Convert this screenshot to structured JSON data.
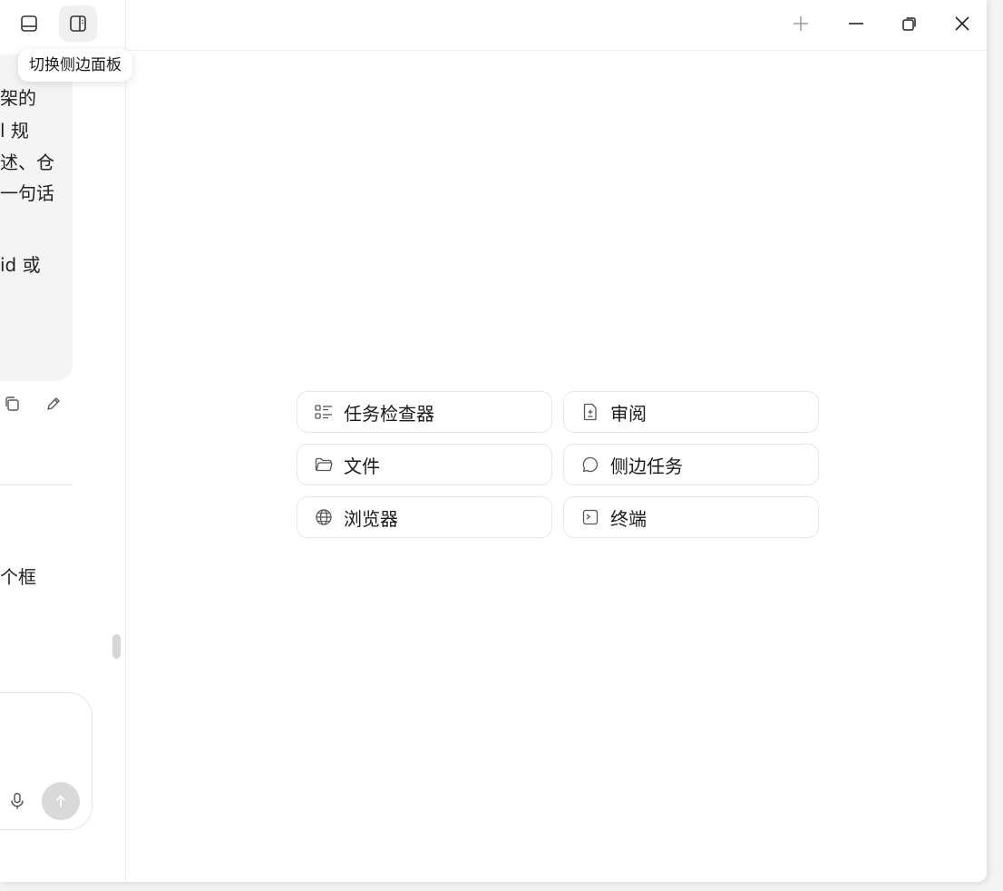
{
  "tooltip": {
    "text": "切换侧边面板"
  },
  "chat": {
    "lines": [
      "架的",
      "l 规",
      "述、仓",
      "一句话",
      "id 或",
      "个框"
    ]
  },
  "actions": [
    {
      "label": "任务检查器",
      "icon": "list-checks-icon"
    },
    {
      "label": "审阅",
      "icon": "file-diff-icon"
    },
    {
      "label": "文件",
      "icon": "folder-icon"
    },
    {
      "label": "侧边任务",
      "icon": "chat-bubble-icon"
    },
    {
      "label": "浏览器",
      "icon": "globe-icon"
    },
    {
      "label": "终端",
      "icon": "terminal-icon"
    }
  ]
}
